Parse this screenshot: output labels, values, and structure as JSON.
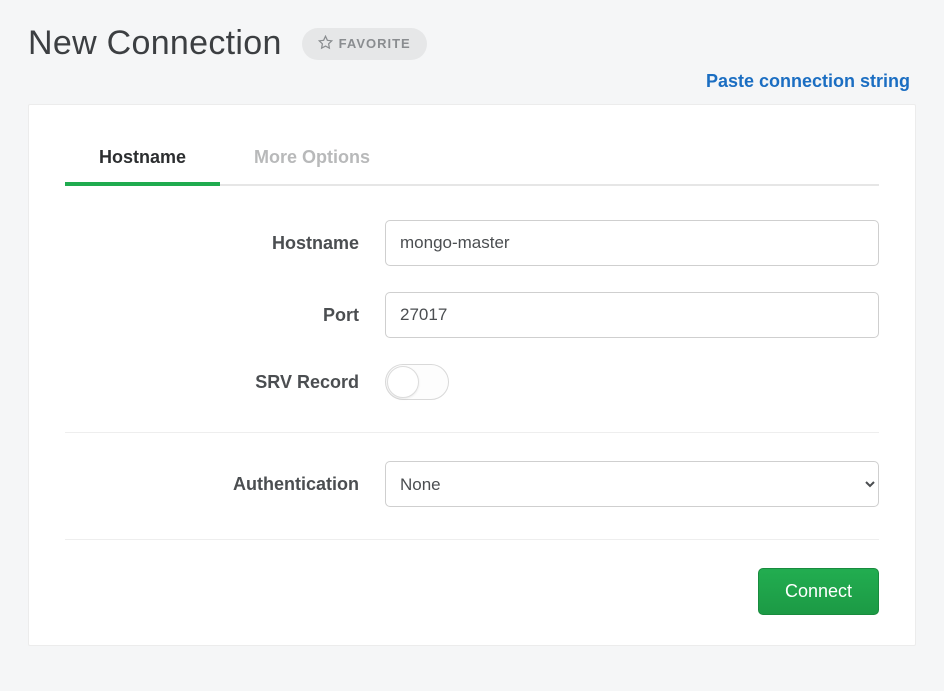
{
  "header": {
    "title": "New Connection",
    "favorite_label": "FAVORITE",
    "paste_link": "Paste connection string"
  },
  "tabs": {
    "hostname": "Hostname",
    "more_options": "More Options"
  },
  "form": {
    "hostname": {
      "label": "Hostname",
      "value": "mongo-master"
    },
    "port": {
      "label": "Port",
      "value": "27017"
    },
    "srv_record": {
      "label": "SRV Record",
      "enabled": false
    },
    "authentication": {
      "label": "Authentication",
      "selected": "None",
      "options": [
        "None"
      ]
    }
  },
  "actions": {
    "connect_label": "Connect"
  }
}
